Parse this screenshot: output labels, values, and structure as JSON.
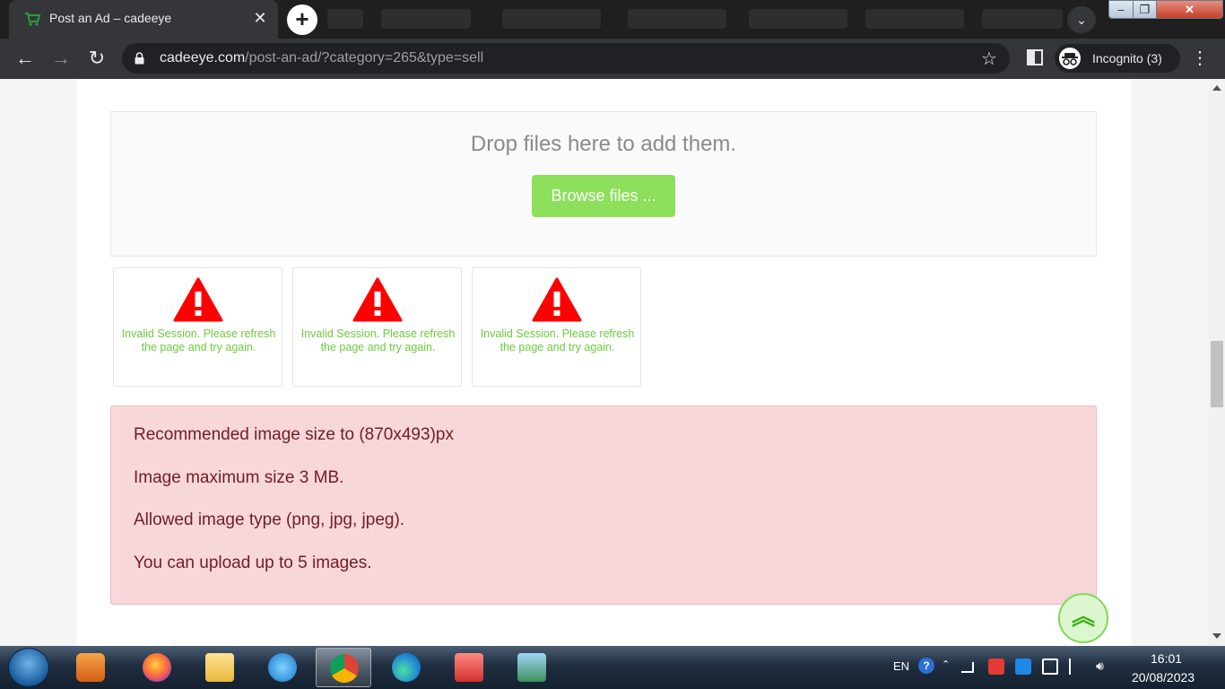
{
  "browser": {
    "active_tab_title": "Post an Ad – cadeeye",
    "url_host": "cadeeye.com",
    "url_path": "/post-an-ad/?category=265&type=sell",
    "incognito_label": "Incognito (3)"
  },
  "upload": {
    "drop_text": "Drop files here to add them.",
    "browse_label": "Browse files ..."
  },
  "thumbnails": [
    {
      "message": "Invalid Session. Please refresh the page and try again."
    },
    {
      "message": "Invalid Session. Please refresh the page and try again."
    },
    {
      "message": "Invalid Session. Please refresh the page and try again."
    }
  ],
  "notice": {
    "lines": [
      "Recommended image size to (870x493)px",
      "Image maximum size 3 MB.",
      "Allowed image type (png, jpg, jpeg).",
      "You can upload up to 5 images."
    ]
  },
  "taskbar": {
    "language": "EN",
    "time": "16:01",
    "date": "20/08/2023"
  },
  "colors": {
    "accent_green": "#8ce05b",
    "warning_red": "#ff0000",
    "alert_bg": "#f7d7da",
    "alert_text": "#721c24"
  },
  "icons": [
    "cart-favicon-icon",
    "close-icon",
    "plus-icon",
    "chevron-down-icon",
    "back-arrow-icon",
    "forward-arrow-icon",
    "reload-icon",
    "lock-icon",
    "star-icon",
    "side-panel-icon",
    "incognito-icon",
    "kebab-menu-icon",
    "warning-triangle-icon",
    "double-chevron-up-icon",
    "windows-start-icon"
  ]
}
